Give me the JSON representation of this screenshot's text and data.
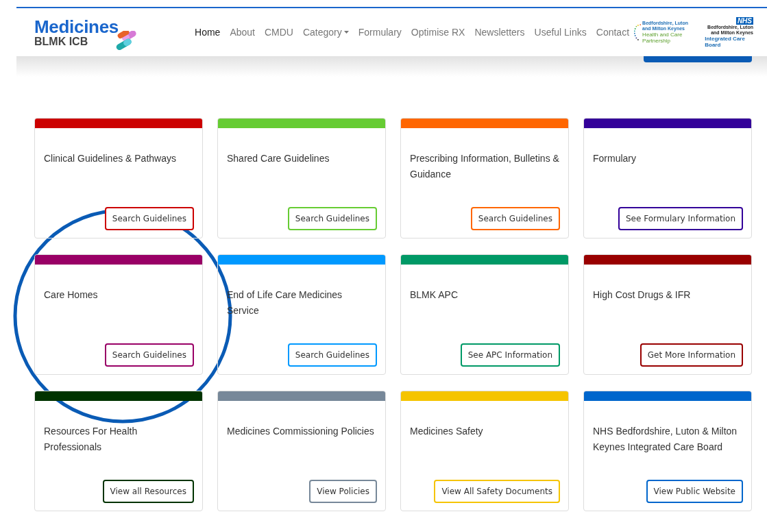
{
  "logo": {
    "title": "Medicines",
    "subtitle": "BLMK ICB"
  },
  "nav": [
    {
      "label": "Home",
      "selected": true
    },
    {
      "label": "About",
      "selected": false
    },
    {
      "label": "CMDU",
      "selected": false
    },
    {
      "label": "Category",
      "selected": false,
      "kind": "dropdown"
    },
    {
      "label": "Formulary",
      "selected": false
    },
    {
      "label": "Optimise RX",
      "selected": false
    },
    {
      "label": "Newsletters",
      "selected": false
    },
    {
      "label": "Useful Links",
      "selected": false
    },
    {
      "label": "Contact",
      "selected": false
    }
  ],
  "partner_logos": [
    {
      "kind": "partnership",
      "lines": [
        "Bedfordshire, Luton",
        "and Milton Keynes"
      ],
      "tagline": "Health and Care Partnership"
    },
    {
      "kind": "nhs",
      "badge": "NHS",
      "lines": [
        "Bedfordshire, Luton",
        "and Milton Keynes"
      ],
      "tagline": "Integrated Care Board"
    }
  ],
  "cards": [
    {
      "title": "Clinical Guidelines & Pathways",
      "button": "Search Guidelines",
      "color": "#cc0000"
    },
    {
      "title": "Shared Care Guidelines",
      "button": "Search Guidelines",
      "color": "#66cc33"
    },
    {
      "title": "Prescribing Information, Bulletins & Guidance",
      "button": "Search Guidelines",
      "color": "#ff6600"
    },
    {
      "title": "Formulary",
      "button": "See Formulary Information",
      "color": "#330099"
    },
    {
      "title": "Care Homes",
      "button": "Search Guidelines",
      "color": "#990066"
    },
    {
      "title": "End of Life Care Medicines Service",
      "button": "Search Guidelines",
      "color": "#0099ff"
    },
    {
      "title": "BLMK APC",
      "button": "See APC Information",
      "color": "#009966"
    },
    {
      "title": "High Cost Drugs & IFR",
      "button": "Get More Information",
      "color": "#990000"
    },
    {
      "title": "Resources For Health Professionals",
      "button": "View all Resources",
      "color": "#003300"
    },
    {
      "title": "Medicines Commissioning Policies",
      "button": "View Policies",
      "color": "#778899"
    },
    {
      "title": "Medicines Safety",
      "button": "View All Safety Documents",
      "color": "#f5c400"
    },
    {
      "title": "NHS Bedfordshire, Luton & Milton Keynes Integrated Care Board",
      "button": "View Public Website",
      "color": "#0066cc"
    }
  ]
}
